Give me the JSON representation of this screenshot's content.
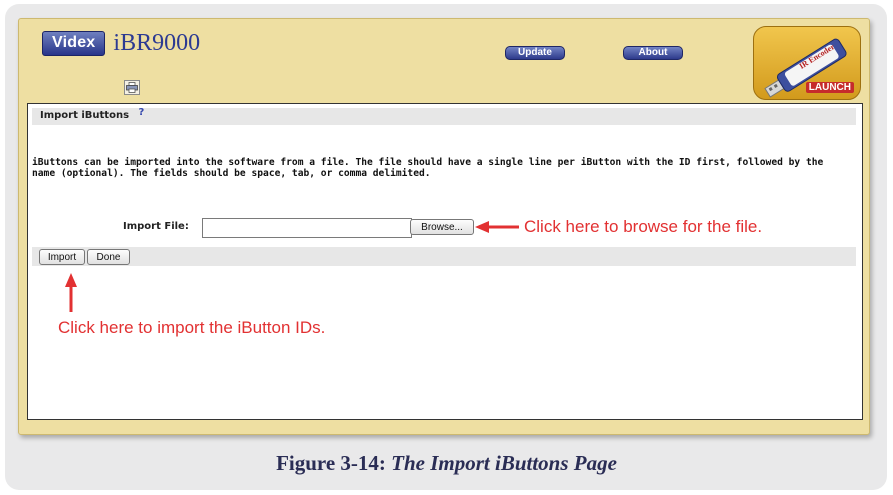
{
  "header": {
    "brand": "Videx",
    "product": "iBR9000",
    "nav": {
      "update_label": "Update",
      "about_label": "About"
    },
    "launch": {
      "logo_text": "IR Encoder",
      "label": "LAUNCH"
    }
  },
  "section": {
    "title": "Import iButtons",
    "help": "?"
  },
  "description": "iButtons can be imported into the software from a file. The file should have a single line per iButton with the ID first, followed by the name (optional). The fields should be space, tab, or comma delimited.",
  "import_form": {
    "label": "Import File:",
    "value": "",
    "browse_label": "Browse..."
  },
  "actions": {
    "import_label": "Import",
    "done_label": "Done"
  },
  "annotations": {
    "browse_note": "Click here to browse for the file.",
    "import_note": "Click here to import the iButton IDs."
  },
  "caption": {
    "prefix": "Figure 3-14:",
    "title": "The Import iButtons Page"
  },
  "colors": {
    "frame": "#eedfa2",
    "annotation": "#e23132",
    "nav_button": "#2d3a8c"
  },
  "icons": {
    "print": "printer-icon",
    "usb": "usb-drive-icon"
  }
}
